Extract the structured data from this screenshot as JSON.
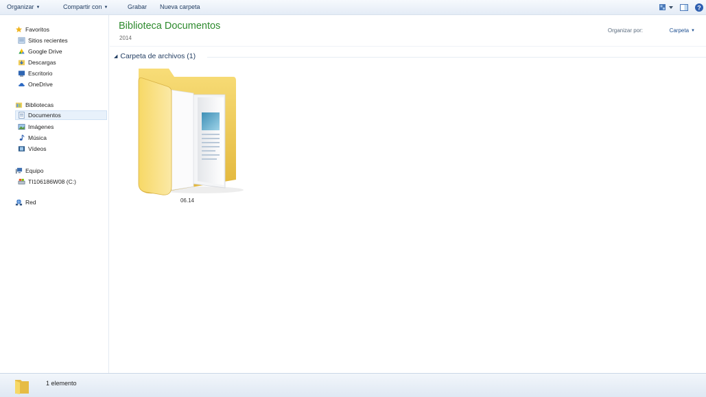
{
  "toolbar": {
    "organize": "Organizar",
    "share": "Compartir con",
    "burn": "Grabar",
    "new_folder": "Nueva carpeta",
    "right_icons": [
      "change-view-icon",
      "preview-pane-icon",
      "help-icon"
    ]
  },
  "sidebar": {
    "favorites": {
      "label": "Favoritos",
      "items": [
        {
          "label": "Sitios recientes",
          "icon": "recent-places-icon"
        },
        {
          "label": "Google Drive",
          "icon": "google-drive-icon"
        },
        {
          "label": "Descargas",
          "icon": "downloads-icon"
        },
        {
          "label": "Escritorio",
          "icon": "desktop-icon"
        },
        {
          "label": "OneDrive",
          "icon": "onedrive-icon"
        }
      ]
    },
    "libraries": {
      "label": "Bibliotecas",
      "items": [
        {
          "label": "Documentos",
          "icon": "documents-icon",
          "selected": true
        },
        {
          "label": "Imágenes",
          "icon": "pictures-icon"
        },
        {
          "label": "Música",
          "icon": "music-icon"
        },
        {
          "label": "Vídeos",
          "icon": "videos-icon"
        }
      ]
    },
    "computer": {
      "label": "Equipo",
      "items": [
        {
          "label": "TI106186W08 (C:)",
          "icon": "drive-icon"
        }
      ]
    },
    "network": {
      "label": "Red"
    }
  },
  "main": {
    "title": "Biblioteca Documentos",
    "subtitle": "2014",
    "arrange_label": "Organizar por:",
    "arrange_value": "Carpeta",
    "group_header": "Carpeta de archivos (1)",
    "items": [
      {
        "name": "06.14",
        "type": "folder"
      }
    ]
  },
  "status": {
    "text": "1 elemento"
  },
  "colors": {
    "title_green": "#2d8a2d",
    "toolbar_text": "#1e3a5f",
    "selection_bg": "#e8f1fb",
    "folder_yellow": "#f3d35a"
  }
}
